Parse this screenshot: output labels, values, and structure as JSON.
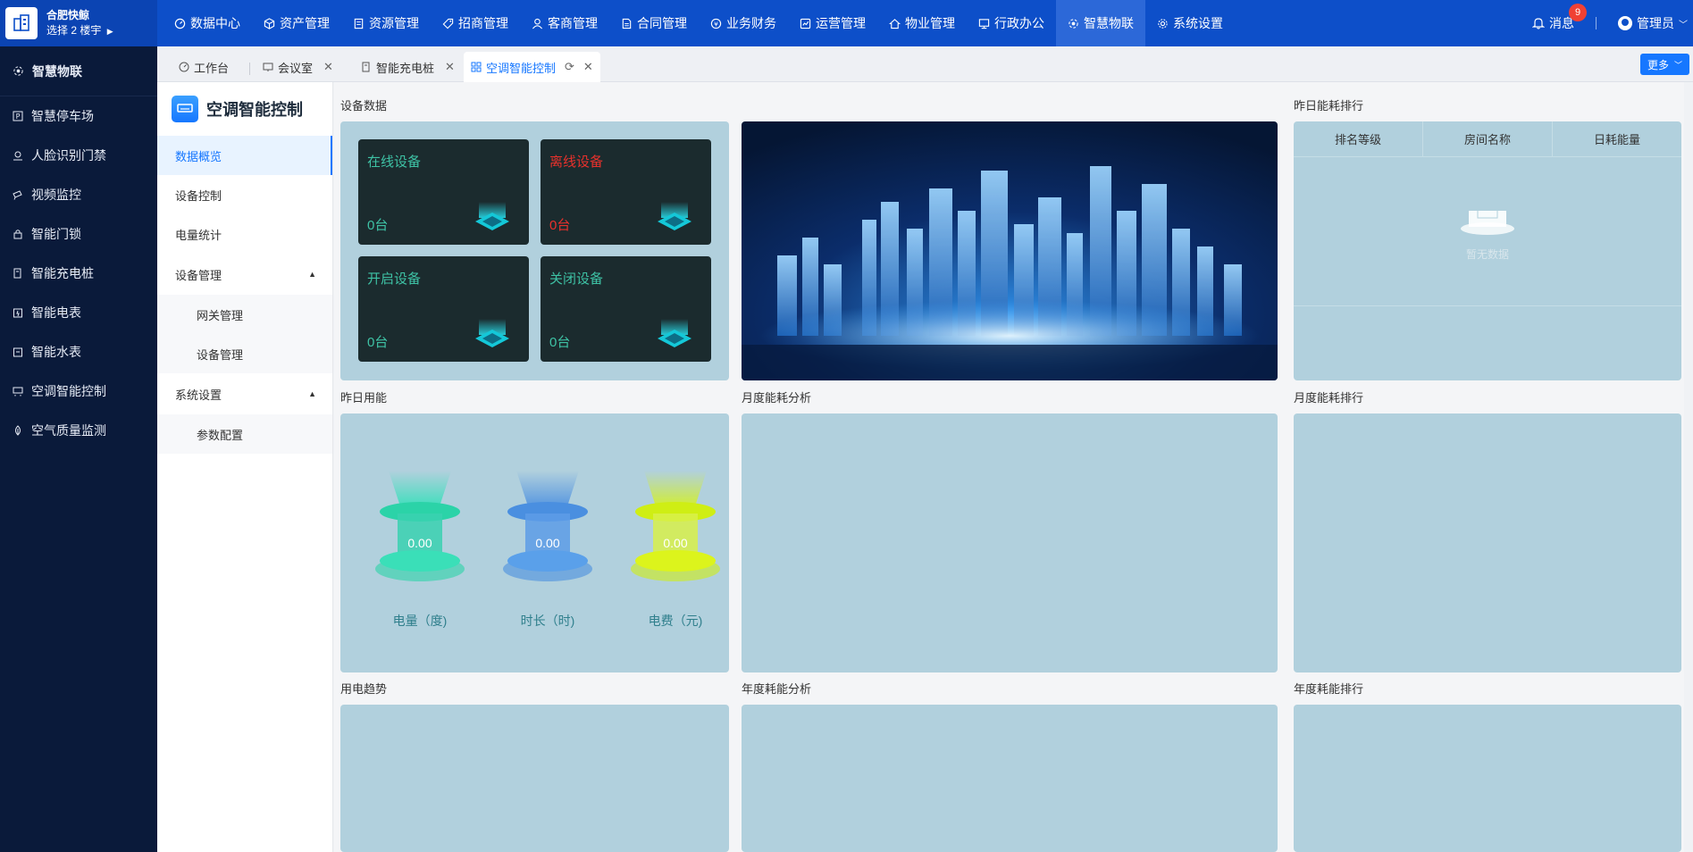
{
  "brand": {
    "name": "合肥快鲸",
    "sub": "选择 2 楼宇"
  },
  "nav": [
    {
      "label": "数据中心",
      "icon": "dashboard-icon"
    },
    {
      "label": "资产管理",
      "icon": "cube-icon"
    },
    {
      "label": "资源管理",
      "icon": "document-icon"
    },
    {
      "label": "招商管理",
      "icon": "tag-icon"
    },
    {
      "label": "客商管理",
      "icon": "user-icon"
    },
    {
      "label": "合同管理",
      "icon": "contract-icon"
    },
    {
      "label": "业务财务",
      "icon": "coin-icon"
    },
    {
      "label": "运营管理",
      "icon": "chart-icon"
    },
    {
      "label": "物业管理",
      "icon": "home-icon"
    },
    {
      "label": "行政办公",
      "icon": "monitor-icon"
    },
    {
      "label": "智慧物联",
      "icon": "iot-icon"
    },
    {
      "label": "系统设置",
      "icon": "gear-icon"
    }
  ],
  "top_right": {
    "message": "消息",
    "badge": "9",
    "user": "管理员"
  },
  "sidebar": {
    "header": "智慧物联",
    "items": [
      "智慧停车场",
      "人脸识别门禁",
      "视频监控",
      "智能门锁",
      "智能充电桩",
      "智能电表",
      "智能水表",
      "空调智能控制",
      "空气质量监测"
    ]
  },
  "tabs": [
    {
      "label": "工作台"
    },
    {
      "label": "会议室"
    },
    {
      "label": "智能充电桩"
    },
    {
      "label": "空调智能控制"
    }
  ],
  "more_label": "更多",
  "submenu": {
    "title": "空调智能控制",
    "overview": "数据概览",
    "control": "设备控制",
    "power_stats": "电量统计",
    "device_mgmt": "设备管理",
    "gateway_mgmt": "网关管理",
    "device_mgmt_child": "设备管理",
    "system_settings": "系统设置",
    "param_config": "参数配置"
  },
  "panels": {
    "device_data": "设备数据",
    "yesterday_rank": "昨日能耗排行",
    "yesterday_usage": "昨日用能",
    "monthly_analysis": "月度能耗分析",
    "monthly_rank": "月度能耗排行",
    "trend": "用电趋势",
    "annual_analysis": "年度耗能分析",
    "annual_rank": "年度耗能排行"
  },
  "devices": {
    "online": {
      "label": "在线设备",
      "value": "0台"
    },
    "offline": {
      "label": "离线设备",
      "value": "0台"
    },
    "on": {
      "label": "开启设备",
      "value": "0台"
    },
    "off": {
      "label": "关闭设备",
      "value": "0台"
    }
  },
  "rank_table": {
    "col1": "排名等级",
    "col2": "房间名称",
    "col3": "日耗能量",
    "empty": "暂无数据"
  },
  "usage": {
    "power": {
      "value": "0.00",
      "label": "电量（度)"
    },
    "duration": {
      "value": "0.00",
      "label": "时长（时)"
    },
    "fee": {
      "value": "0.00",
      "label": "电费（元)"
    }
  },
  "colors": {
    "primary": "#0d4fc9",
    "sidebar": "#0a1a3a",
    "panel": "#b1d0dd",
    "teal": "#3ec2a5",
    "red": "#e8312c"
  }
}
